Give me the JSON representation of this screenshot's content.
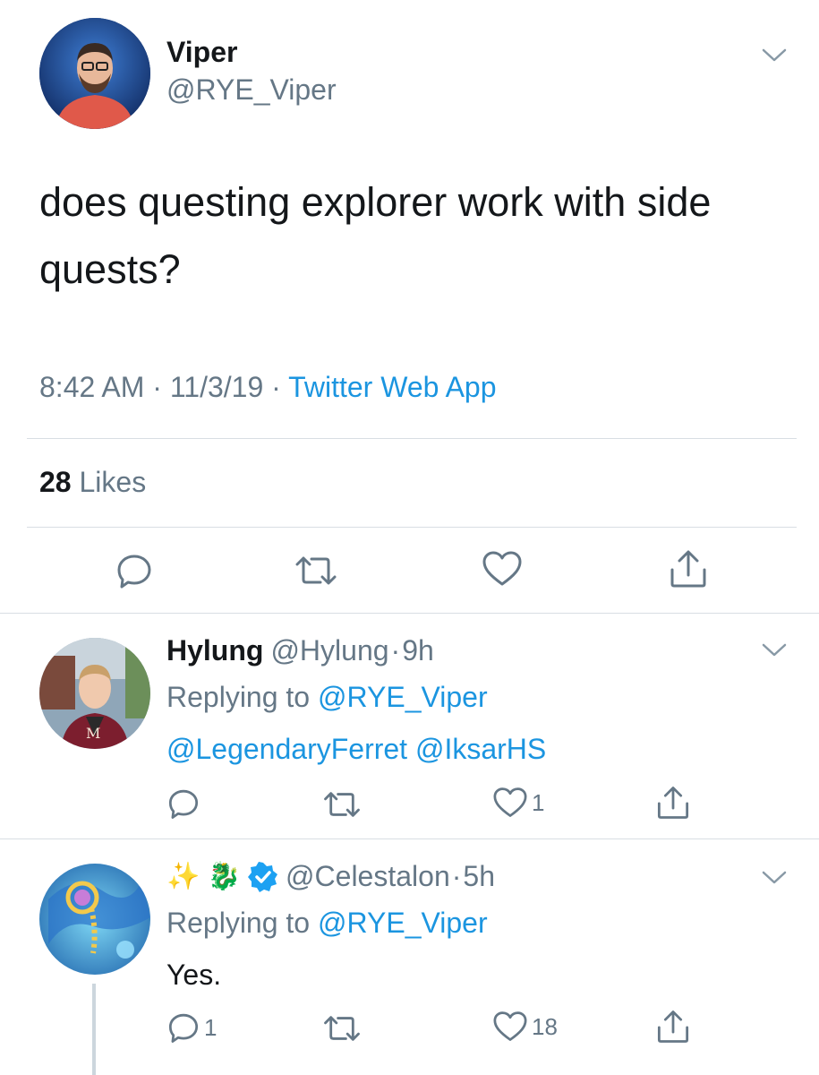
{
  "main_tweet": {
    "name": "Viper",
    "handle": "@RYE_Viper",
    "text": "does questing explorer work with side quests?",
    "time": "8:42 AM",
    "date": "11/3/19",
    "source": "Twitter Web App",
    "likes_count": "28",
    "likes_label": "Likes"
  },
  "replies": [
    {
      "name": "Hylung",
      "handle": "@Hylung",
      "age": "9h",
      "replying_label": "Replying to",
      "replying_to": "@RYE_Viper",
      "text": "@LegendaryFerret @IksarHS",
      "reply_count": "",
      "retweet_count": "",
      "like_count": "1"
    },
    {
      "name_emoji": "✨ 🐉",
      "verified": true,
      "handle": "@Celestalon",
      "age": "5h",
      "replying_label": "Replying to",
      "replying_to": "@RYE_Viper",
      "text": "Yes.",
      "reply_count": "1",
      "retweet_count": "",
      "like_count": "18"
    }
  ],
  "colors": {
    "link": "#1b95e0",
    "muted": "#657786",
    "text": "#14171a",
    "divider": "#d8dee3"
  },
  "icons": [
    "reply-icon",
    "retweet-icon",
    "like-icon",
    "share-icon",
    "chevron-down-icon",
    "verified-badge-icon"
  ]
}
